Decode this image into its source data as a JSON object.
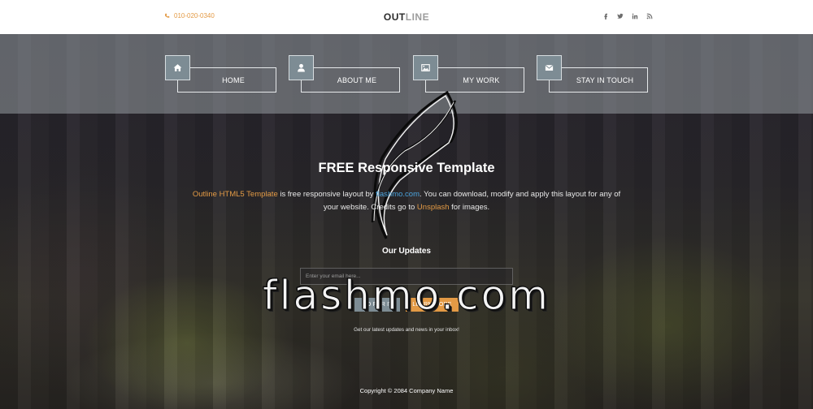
{
  "header": {
    "phone": "010-020-0340",
    "logo_primary": "OUT",
    "logo_secondary": "LINE",
    "social_icons": [
      "facebook-icon",
      "twitter-icon",
      "linkedin-icon",
      "rss-icon"
    ]
  },
  "nav": {
    "items": [
      {
        "label": "HOME",
        "icon": "home-icon"
      },
      {
        "label": "ABOUT ME",
        "icon": "user-icon"
      },
      {
        "label": "MY WORK",
        "icon": "image-icon"
      },
      {
        "label": "STAY IN TOUCH",
        "icon": "envelope-icon"
      }
    ]
  },
  "hero": {
    "title": "FREE Responsive Template",
    "intro_link1": "Outline HTML5 Template",
    "intro_text1": " is free responsive layout by ",
    "intro_link2": "flashmo.com",
    "intro_text2": ". You can download, modify and apply this layout for any of your website. Credits go to ",
    "intro_link3": "Unsplash",
    "intro_text3": " for images."
  },
  "subscribe": {
    "title": "Our Updates",
    "email_placeholder": "Enter your email here...",
    "go_button": "GO FOR IT",
    "learn_button": "LEARN MORE",
    "note": "Get our latest updates and news in your inbox!"
  },
  "footer": {
    "copyright": "Copyright © 2084 Company Name"
  },
  "watermark": "flashmo.com",
  "colors": {
    "accent_orange": "#e39a45",
    "accent_blue": "#4aa3dd",
    "nav_icon_bg": "#7d8c94"
  }
}
